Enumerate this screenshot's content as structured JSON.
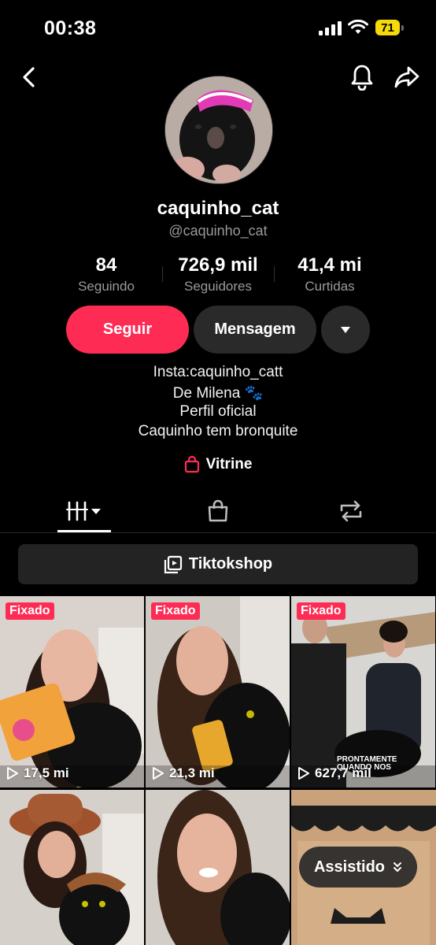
{
  "status_bar": {
    "time": "00:38",
    "battery": "71"
  },
  "profile": {
    "username": "caquinho_cat",
    "handle": "@caquinho_cat",
    "stats": [
      {
        "value": "84",
        "label": "Seguindo"
      },
      {
        "value": "726,9 mil",
        "label": "Seguidores"
      },
      {
        "value": "41,4 mi",
        "label": "Curtidas"
      }
    ],
    "follow_label": "Seguir",
    "message_label": "Mensagem",
    "bio": [
      "Insta:caquinho_catt",
      "De Milena 🐾",
      "Perfil oficial",
      "Caquinho tem bronquite"
    ],
    "vitrine_label": "Vitrine"
  },
  "shop_bar": {
    "label": "Tiktokshop"
  },
  "grid": [
    {
      "pinned": "Fixado",
      "views": "17,5 mi"
    },
    {
      "pinned": "Fixado",
      "views": "21,3 mi"
    },
    {
      "pinned": "Fixado",
      "views": "627,7 mil",
      "overlay": "PRONTAMENTE QUANDO NOS"
    },
    {
      "pinned": "",
      "views": ""
    },
    {
      "pinned": "",
      "views": ""
    },
    {
      "pinned": "",
      "views": ""
    }
  ],
  "assistido_label": "Assistido",
  "colors": {
    "accent": "#fe2c55",
    "battery": "#f5d90a"
  }
}
